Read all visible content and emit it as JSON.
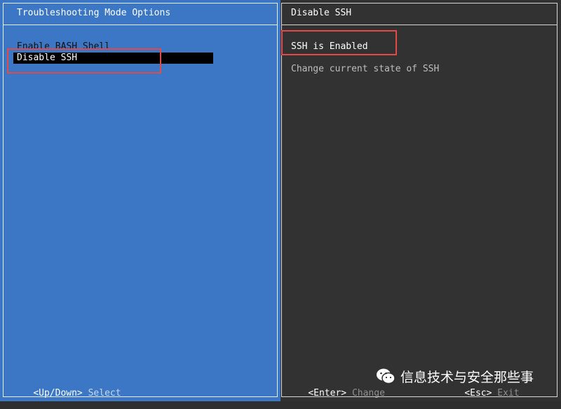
{
  "left_panel": {
    "title": "Troubleshooting Mode Options",
    "items": [
      {
        "label": "Enable BASH Shell"
      },
      {
        "label": "Disable SSH"
      }
    ],
    "footer": {
      "key": "<Up/Down>",
      "action": "Select"
    }
  },
  "right_panel": {
    "title": "Disable SSH",
    "status": "SSH is Enabled",
    "description": "Change current state of SSH",
    "footer_enter": {
      "key": "<Enter>",
      "action": "Change"
    },
    "footer_esc": {
      "key": "<Esc>",
      "action": "Exit"
    }
  },
  "watermark": {
    "text": "信息技术与安全那些事"
  },
  "colors": {
    "left_bg": "#3b77c4",
    "right_bg": "#323232",
    "selection_bg": "#000000",
    "highlight_box": "#e34a47"
  }
}
